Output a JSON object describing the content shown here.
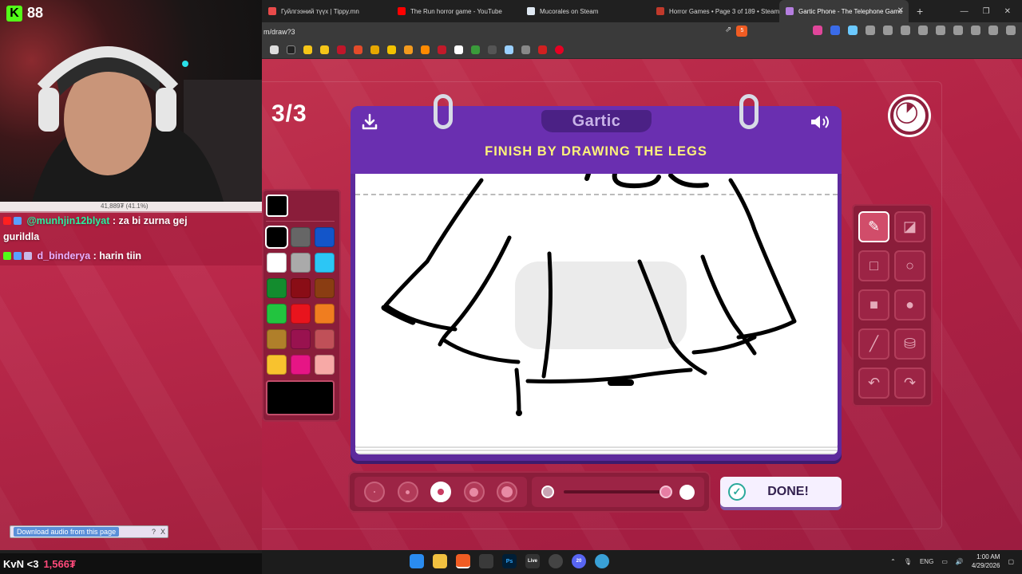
{
  "browser": {
    "tabs": [
      {
        "title": "Гуйлгээний түүх | Tippy.mn",
        "color": "#e84a4a"
      },
      {
        "title": "The Run horror game - YouTube",
        "color": "#ff0000"
      },
      {
        "title": "Mucorales on Steam",
        "color": "#1b2838"
      },
      {
        "title": "Horror Games • Page 3 of 189 • Steam",
        "color": "#c0392b"
      },
      {
        "title": "Gartic Phone - The Telephone Game",
        "color": "#8e44ad"
      }
    ],
    "new_tab": "+",
    "url": "m/draw?3",
    "brave_badge": "5"
  },
  "game": {
    "round": "3/3",
    "logo": "Gartic",
    "instruction": "FINISH BY DRAWING THE LEGS",
    "done_label": "DONE!",
    "brush_sizes": 5,
    "selected_brush_size": 3,
    "opacity_percent": 100,
    "palette": {
      "current": "#000000",
      "swatches": [
        "#000000",
        "#666666",
        "#1355c9",
        "#ffffff",
        "#aaaaaa",
        "#2cc6f5",
        "#138c2e",
        "#8a0d16",
        "#8a3d12",
        "#22c43f",
        "#e8141d",
        "#f07d1f",
        "#b07f2a",
        "#99124f",
        "#c05058",
        "#f8c22e",
        "#e61585",
        "#f7a9a6"
      ],
      "selected_index": 0
    },
    "tools": [
      {
        "name": "pen-tool",
        "active": true
      },
      {
        "name": "eraser-tool",
        "active": false
      },
      {
        "name": "rectangle-outline-tool",
        "active": false
      },
      {
        "name": "ellipse-outline-tool",
        "active": false
      },
      {
        "name": "rectangle-fill-tool",
        "active": false
      },
      {
        "name": "ellipse-fill-tool",
        "active": false
      },
      {
        "name": "line-tool",
        "active": false
      },
      {
        "name": "fill-bucket-tool",
        "active": false
      },
      {
        "name": "undo-tool",
        "active": false
      },
      {
        "name": "redo-tool",
        "active": false
      }
    ]
  },
  "stream": {
    "viewer_count": "88",
    "cam_caption": "41,889₮ (41.1%)",
    "chat": [
      {
        "user": "@munhjin12blyat",
        "message": ": za bi zurna gej",
        "cont": "gurildla"
      },
      {
        "user": "d_binderya",
        "message": ": harin tiin"
      }
    ],
    "footer_name": "KvN <3",
    "footer_subs": "1,566₮",
    "download_audio": "Download audio from this page",
    "download_help": "?",
    "download_close": "X"
  },
  "taskbar": {
    "lang": "ENG",
    "time": "1:00 AM",
    "date": "4/29/2026",
    "live_badge": "Live",
    "ps_label": "Ps",
    "discord_badge": "20"
  }
}
